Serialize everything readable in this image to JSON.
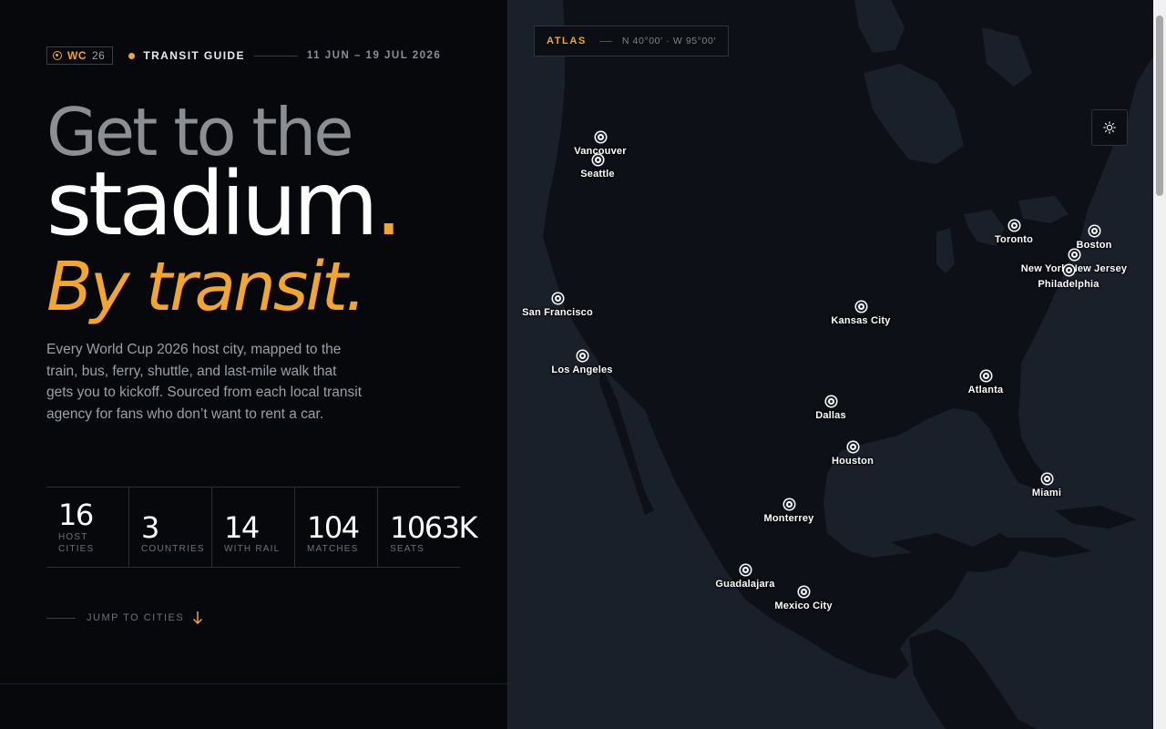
{
  "header": {
    "badge_wc": "WC",
    "badge_year": "26",
    "guide_label": "TRANSIT GUIDE",
    "dates": "11 JUN – 19 JUL 2026"
  },
  "hero": {
    "line1": "Get to the",
    "line2": "stadium",
    "line2_dot": ".",
    "line3": "By transit.",
    "description": "Every World Cup 2026 host city, mapped to the train, bus, ferry, shuttle, and last-mile walk that gets you to kickoff. Sourced from each local transit agency for fans who don’t want to rent a car."
  },
  "stats": [
    {
      "value": "16",
      "label1": "HOST",
      "label2": "CITIES"
    },
    {
      "value": "3",
      "label1": "COUNTRIES",
      "label2": ""
    },
    {
      "value": "14",
      "label1": "WITH RAIL",
      "label2": ""
    },
    {
      "value": "104",
      "label1": "MATCHES",
      "label2": ""
    },
    {
      "value": "1063K",
      "label1": "SEATS",
      "label2": ""
    }
  ],
  "jump": {
    "label": "JUMP TO CITIES"
  },
  "map": {
    "title": "ATLAS",
    "coords": "N 40°00′ · W 95°00′",
    "theme_icon": "sun-icon",
    "cities": [
      {
        "id": "vancouver",
        "name": "Vancouver"
      },
      {
        "id": "seattle",
        "name": "Seattle"
      },
      {
        "id": "san-francisco",
        "name": "San Francisco"
      },
      {
        "id": "los-angeles",
        "name": "Los Angeles"
      },
      {
        "id": "kansas-city",
        "name": "Kansas City"
      },
      {
        "id": "dallas",
        "name": "Dallas"
      },
      {
        "id": "houston",
        "name": "Houston"
      },
      {
        "id": "monterrey",
        "name": "Monterrey"
      },
      {
        "id": "guadalajara",
        "name": "Guadalajara"
      },
      {
        "id": "mexico-city",
        "name": "Mexico City"
      },
      {
        "id": "atlanta",
        "name": "Atlanta"
      },
      {
        "id": "miami",
        "name": "Miami"
      },
      {
        "id": "toronto",
        "name": "Toronto"
      },
      {
        "id": "boston",
        "name": "Boston"
      },
      {
        "id": "new-york-new-jersey",
        "name": "New York/New Jersey"
      },
      {
        "id": "philadelphia",
        "name": "Philadelphia"
      }
    ]
  },
  "colors": {
    "accent": "#f4a52e",
    "background": "#06080c",
    "map_water": "#1a2029",
    "map_land": "#0d1016"
  }
}
